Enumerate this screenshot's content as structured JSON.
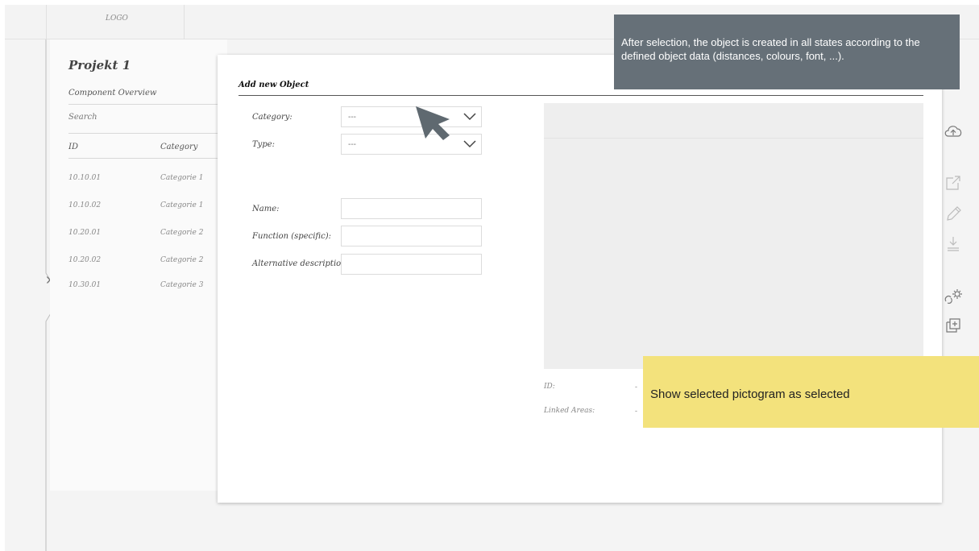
{
  "header": {
    "logo": "LOGO"
  },
  "project": {
    "title": "Projekt 1",
    "section": "Component Overview",
    "search_placeholder": "Search",
    "columns": {
      "id": "ID",
      "category": "Category"
    },
    "rows": [
      {
        "id": "10.10.01",
        "category": "Categorie 1"
      },
      {
        "id": "10.10.02",
        "category": "Categorie 1"
      },
      {
        "id": "10.20.01",
        "category": "Categorie 2"
      },
      {
        "id": "10.20.02",
        "category": "Categorie 2"
      },
      {
        "id": "10.30.01",
        "category": "Categorie 3"
      }
    ]
  },
  "modal": {
    "title": "Add new Object",
    "category_label": "Category:",
    "category_value": "---",
    "type_label": "Type:",
    "type_value": "---",
    "name_label": "Name:",
    "function_label": "Function (specific):",
    "alt_label": "Alternative description:",
    "id_label": "ID:",
    "linked_label": "Linked Areas:",
    "dash": "-"
  },
  "annotations": {
    "top_note": "After selection, the object is created in all states according to the defined object data (distances, colours, font, ...).",
    "yellow_note": "Show selected pictogram as selected"
  },
  "colors": {
    "annotation_dark": "#667078",
    "annotation_yellow": "#f3e27c",
    "cursor": "#5f6970"
  },
  "icons": [
    "cloud-upload-icon",
    "external-link-icon",
    "pencil-icon",
    "download-icon",
    "settings-link-icon",
    "add-copy-icon",
    "expand-sidebar-icon",
    "chevron-down-icon"
  ]
}
